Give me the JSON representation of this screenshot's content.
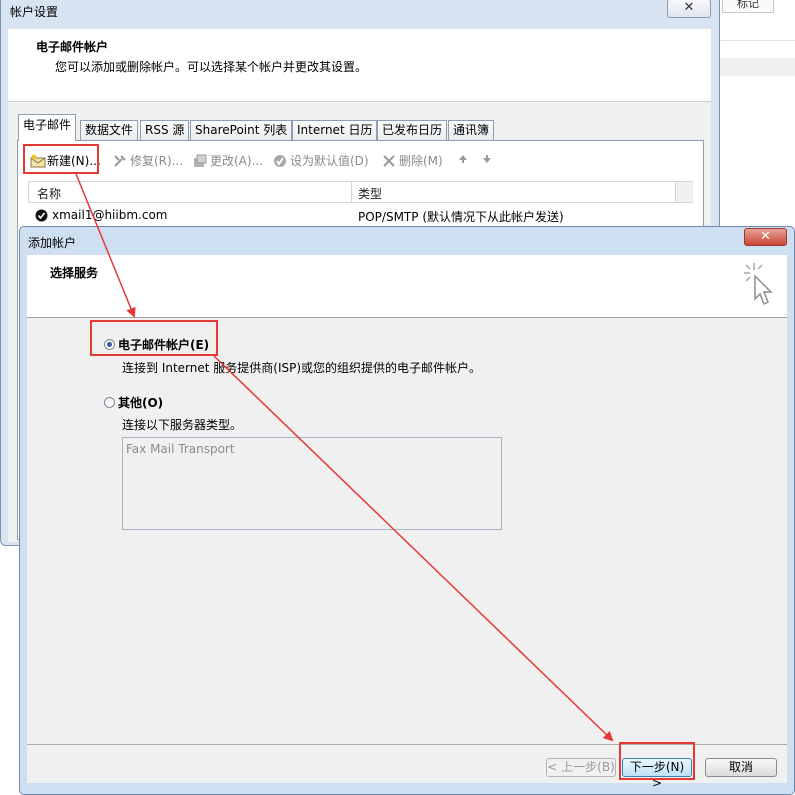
{
  "background": {
    "tag_label": "标记"
  },
  "account_settings": {
    "title": "帐户设置",
    "close_symbol": "✕",
    "header_title": "电子邮件帐户",
    "header_desc": "您可以添加或删除帐户。可以选择某个帐户并更改其设置。",
    "tabs": [
      {
        "label": "电子邮件",
        "active": true
      },
      {
        "label": "数据文件"
      },
      {
        "label": "RSS 源"
      },
      {
        "label": "SharePoint 列表"
      },
      {
        "label": "Internet 日历"
      },
      {
        "label": "已发布日历"
      },
      {
        "label": "通讯簿"
      }
    ],
    "toolbar": {
      "new": "新建(N)...",
      "repair": "修复(R)...",
      "change": "更改(A)...",
      "set_default": "设为默认值(D)",
      "remove": "删除(M)"
    },
    "columns": [
      "名称",
      "类型"
    ],
    "rows": [
      {
        "name": "xmail1@hiibm.com",
        "type": "POP/SMTP (默认情况下从此帐户发送)"
      }
    ]
  },
  "add_account": {
    "title": "添加帐户",
    "close_symbol": "✕",
    "header_title": "选择服务",
    "options": [
      {
        "label": "电子邮件帐户(E)",
        "desc": "连接到 Internet 服务提供商(ISP)或您的组织提供的电子邮件帐户。",
        "selected": true
      },
      {
        "label": "其他(O)",
        "desc": "连接以下服务器类型。",
        "selected": false
      }
    ],
    "server_types": [
      "Fax Mail Transport"
    ],
    "buttons": {
      "back": "< 上一步(B)",
      "next": "下一步(N) >",
      "cancel": "取消"
    }
  },
  "colors": {
    "annotation": "#e53935",
    "window_frame": "#cfdff2"
  }
}
